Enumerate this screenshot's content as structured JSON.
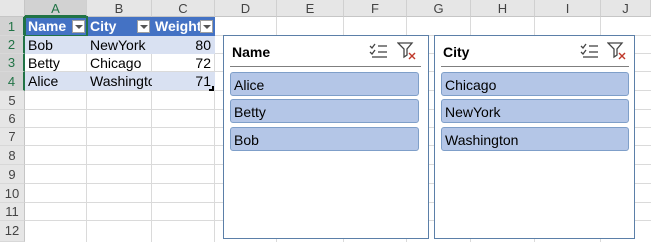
{
  "columns": [
    "A",
    "B",
    "C",
    "D",
    "E",
    "F",
    "G",
    "H",
    "I",
    "J"
  ],
  "rows": [
    "1",
    "2",
    "3",
    "4",
    "5",
    "6",
    "7",
    "8",
    "9",
    "10",
    "11",
    "12"
  ],
  "table": {
    "headers": [
      "Name",
      "City",
      "Weight"
    ],
    "rows": [
      [
        "Bob",
        "NewYork",
        "80"
      ],
      [
        "Betty",
        "Chicago",
        "72"
      ],
      [
        "Alice",
        "Washingto",
        "71"
      ]
    ]
  },
  "slicers": [
    {
      "title": "Name",
      "items": [
        "Alice",
        "Betty",
        "Bob"
      ]
    },
    {
      "title": "City",
      "items": [
        "Chicago",
        "NewYork",
        "Washington"
      ]
    }
  ],
  "colors": {
    "table_header": "#4472c4",
    "band": "#d9e1f2",
    "slicer_item": "#b4c6e7",
    "selection": "#217346"
  },
  "icons": {
    "multi_select": "multi-select-icon",
    "clear_filter": "clear-filter-icon"
  }
}
